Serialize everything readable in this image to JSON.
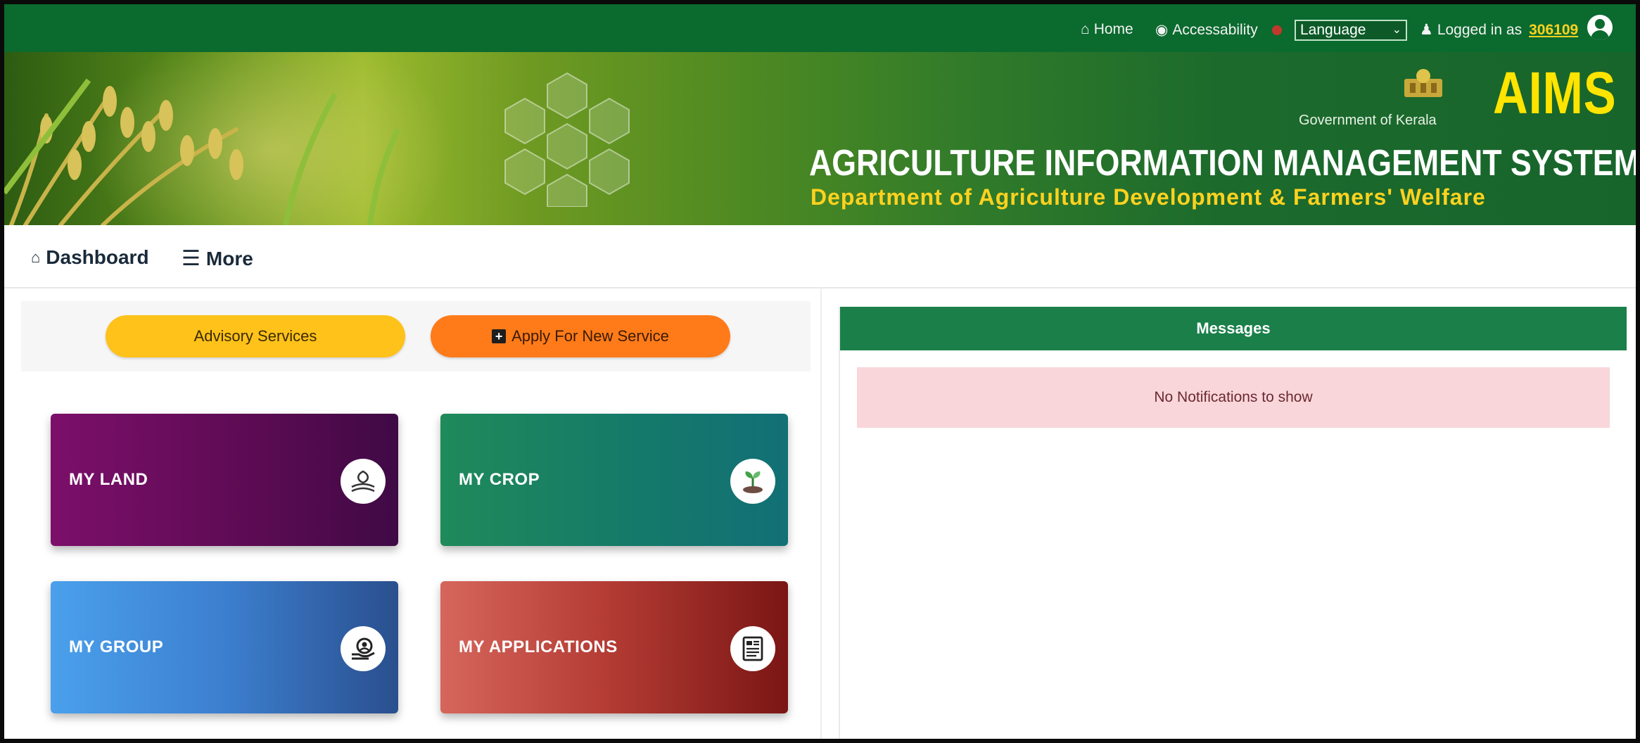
{
  "topbar": {
    "home": "Home",
    "accessibility": "Accessability",
    "language": "Language",
    "logged_in_prefix": "Logged in as",
    "user_id": "306109"
  },
  "banner": {
    "government": "Government of Kerala",
    "brand": "AIMS",
    "title": "AGRICULTURE INFORMATION MANAGEMENT SYSTEM",
    "subtitle": "Department of Agriculture Development & Farmers' Welfare"
  },
  "nav": {
    "dashboard": "Dashboard",
    "more": "More"
  },
  "actions": {
    "advisory": "Advisory Services",
    "apply": "Apply For New Service"
  },
  "cards": {
    "land": {
      "label": "MY LAND",
      "icon": "land-icon",
      "color": "#6b0d5e"
    },
    "crop": {
      "label": "MY CROP",
      "icon": "seedling-icon",
      "color": "#17806a"
    },
    "group": {
      "label": "MY GROUP",
      "icon": "group-hand-icon",
      "color": "#3c7fcf"
    },
    "apps": {
      "label": "MY APPLICATIONS",
      "icon": "document-icon",
      "color": "#a5302b"
    }
  },
  "messages": {
    "header": "Messages",
    "empty": "No Notifications to show"
  },
  "colors": {
    "primary_green": "#0b6a2e",
    "accent_yellow": "#ffe400",
    "advisory_pill": "#ffc21a",
    "apply_pill": "#ff7b1a",
    "alert_bg": "#f9d6da"
  }
}
